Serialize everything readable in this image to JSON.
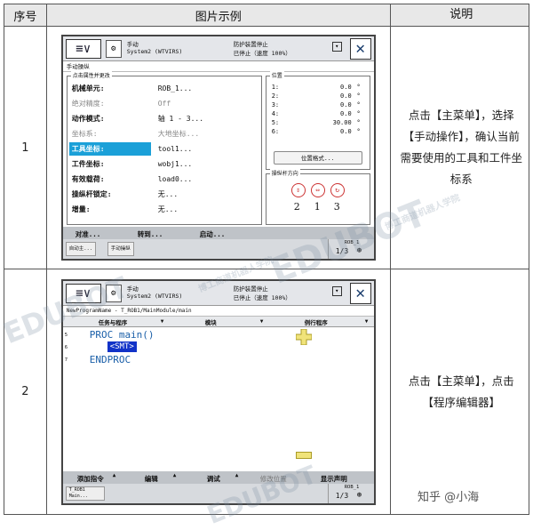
{
  "table": {
    "headers": [
      "序号",
      "图片示例",
      "说明"
    ],
    "rows": [
      {
        "num": "1",
        "desc": "点击【主菜单】，选择【手动操作】，确认当前需要使用的工具和工件坐标系"
      },
      {
        "num": "2",
        "desc": "点击【主菜单】，点击【程序编辑器】"
      }
    ]
  },
  "screen1": {
    "menu_label": "≡∨",
    "tb_l1": "手动",
    "tb_l2": "System2 (WTVIRS)",
    "tb_r1": "防护装置停止",
    "tb_r2": "已停止（速度 100%）",
    "title": "手动操纵",
    "prop_caption": "点击属性并更改",
    "props": [
      {
        "k": "机械单元:",
        "v": "ROB_1..."
      },
      {
        "k": "绝对精度:",
        "v": "Off"
      },
      {
        "k": "动作模式:",
        "v": "轴 1 - 3..."
      },
      {
        "k": "坐标系:",
        "v": "大地坐标..."
      },
      {
        "k": "工具坐标:",
        "v": "tool1..."
      },
      {
        "k": "工件坐标:",
        "v": "wobj1..."
      },
      {
        "k": "有效载荷:",
        "v": "load0..."
      },
      {
        "k": "操纵杆锁定:",
        "v": "无..."
      },
      {
        "k": "增量:",
        "v": "无..."
      }
    ],
    "pos_caption": "位置",
    "positions": [
      {
        "n": "1:",
        "v": "0.0"
      },
      {
        "n": "2:",
        "v": "0.0"
      },
      {
        "n": "3:",
        "v": "0.0"
      },
      {
        "n": "4:",
        "v": "0.0"
      },
      {
        "n": "5:",
        "v": "30.00"
      },
      {
        "n": "6:",
        "v": "0.0"
      }
    ],
    "deg": "°",
    "pos_format": "位置格式...",
    "dir_caption": "操纵杆方向",
    "dir_nums": [
      "2",
      "1",
      "3"
    ],
    "bottom": [
      "对准...",
      "转到...",
      "启动..."
    ],
    "task1": "自动主...",
    "task2": "手动操纵",
    "rob_label": "ROB_1",
    "rob_frac": "1/3"
  },
  "screen2": {
    "menu_label": "≡∨",
    "tb_l1": "手动",
    "tb_l2": "System2 (WTVIRS)",
    "tb_r1": "防护装置停止",
    "tb_r2": "已停止（速度 100%）",
    "path": "NewProgramName - T_ROB1/MainModule/main",
    "tabs": [
      "任务与程序",
      "模块",
      "例行程序"
    ],
    "lines": [
      "5",
      "6",
      "7"
    ],
    "code_l1": "PROC main()",
    "code_smt": "<SMT>",
    "code_l3": "ENDPROC",
    "bottom": [
      "添加指令",
      "编辑",
      "调试",
      "修改位置",
      "显示声明"
    ],
    "task1": "T_ROB1 Main...",
    "rob_label": "ROB_1",
    "rob_frac": "1/3"
  },
  "watermarks": [
    "EDUBOT",
    "博工商道机器人学院",
    "EDUBOT",
    "博工商道机器人学院",
    "EDUBOT"
  ],
  "footer": "知乎 @小海"
}
